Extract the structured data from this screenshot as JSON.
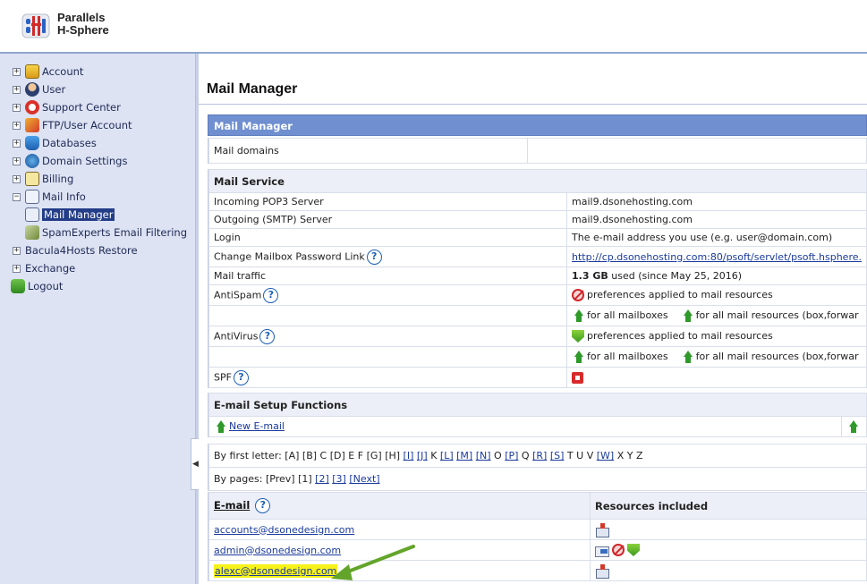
{
  "brand": {
    "line1": "Parallels",
    "line2": "H-Sphere"
  },
  "sidebar": {
    "items": [
      {
        "label": "Account",
        "expander": "+",
        "icon": "account-icon"
      },
      {
        "label": "User",
        "expander": "+",
        "icon": "user-icon"
      },
      {
        "label": "Support Center",
        "expander": "+",
        "icon": "support-lifebuoy-icon"
      },
      {
        "label": "FTP/User Account",
        "expander": "+",
        "icon": "ftp-lock-icon"
      },
      {
        "label": "Databases",
        "expander": "+",
        "icon": "database-icon"
      },
      {
        "label": "Domain Settings",
        "expander": "+",
        "icon": "domain-globe-icon"
      },
      {
        "label": "Billing",
        "expander": "+",
        "icon": "billing-icon"
      },
      {
        "label": "Mail Info",
        "expander": "−",
        "icon": "mail-info-icon"
      },
      {
        "label": "Mail Manager",
        "child": true,
        "selected": true,
        "icon": "mail-manager-icon"
      },
      {
        "label": "SpamExperts Email Filtering",
        "child": true,
        "icon": "spamexperts-icon"
      },
      {
        "label": "Bacula4Hosts Restore",
        "expander": "+",
        "icon": ""
      },
      {
        "label": "Exchange",
        "expander": "+",
        "icon": ""
      },
      {
        "label": "Logout",
        "icon": "logout-icon"
      }
    ]
  },
  "page": {
    "title": "Mail Manager"
  },
  "panel": {
    "header": "Mail Manager",
    "mail_domains_label": "Mail domains",
    "mail_service": {
      "heading": "Mail Service",
      "rows": {
        "pop3_label": "Incoming POP3 Server",
        "pop3_value": "mail9.dsonehosting.com",
        "smtp_label": "Outgoing (SMTP) Server",
        "smtp_value": "mail9.dsonehosting.com",
        "login_label": "Login",
        "login_value": "The e-mail address you use (e.g. user@domain.com)",
        "pwlink_label": "Change Mailbox Password Link",
        "pwlink_value": "http://cp.dsonehosting.com:80/psoft/servlet/psoft.hsphere.",
        "traffic_label": "Mail traffic",
        "traffic_amount": "1.3 GB",
        "traffic_rest": "used (since May 25, 2016)",
        "antispam_label": "AntiSpam",
        "antispam_value": "preferences applied to mail resources",
        "antivirus_label": "AntiVirus",
        "antivirus_value": "preferences applied to mail resources",
        "all_mailboxes": "for all mailboxes",
        "all_resources": "for all mail resources (box,forwar",
        "spf_label": "SPF"
      }
    },
    "setup": {
      "heading": "E-mail Setup Functions",
      "new_email": "New E-mail"
    },
    "letters": {
      "label": "By first letter:",
      "items": [
        {
          "t": "[A]",
          "link": false
        },
        {
          "t": "[B]",
          "link": false
        },
        {
          "t": "C",
          "link": false
        },
        {
          "t": "[D]",
          "link": false
        },
        {
          "t": "E",
          "link": false
        },
        {
          "t": "F",
          "link": false
        },
        {
          "t": "[G]",
          "link": false
        },
        {
          "t": "[H]",
          "link": false
        },
        {
          "t": "[I]",
          "link": true
        },
        {
          "t": "[J]",
          "link": true
        },
        {
          "t": "K",
          "link": false
        },
        {
          "t": "[L]",
          "link": true
        },
        {
          "t": "[M]",
          "link": true
        },
        {
          "t": "[N]",
          "link": true
        },
        {
          "t": "O",
          "link": false
        },
        {
          "t": "[P]",
          "link": true
        },
        {
          "t": "Q",
          "link": false
        },
        {
          "t": "[R]",
          "link": true
        },
        {
          "t": "[S]",
          "link": true
        },
        {
          "t": "T",
          "link": false
        },
        {
          "t": "U",
          "link": false
        },
        {
          "t": "V",
          "link": false
        },
        {
          "t": "[W]",
          "link": true
        },
        {
          "t": "X",
          "link": false
        },
        {
          "t": "Y",
          "link": false
        },
        {
          "t": "Z",
          "link": false
        }
      ]
    },
    "pages": {
      "label": "By pages:",
      "prev": "[Prev]",
      "current": "[1]",
      "p2": "[2]",
      "p3": "[3]",
      "next": "[Next]"
    },
    "email_table": {
      "col_email": "E-mail",
      "col_resources": "Resources included",
      "rows": [
        {
          "email": "accounts@dsonedesign.com",
          "icons": [
            "mailbox-icon"
          ],
          "highlight": false
        },
        {
          "email": "admin@dsonedesign.com",
          "icons": [
            "forward-icon",
            "antispam-icon",
            "antivirus-shield-icon"
          ],
          "highlight": false
        },
        {
          "email": "alexc@dsonedesign.com",
          "icons": [
            "mailbox-icon"
          ],
          "highlight": true
        }
      ]
    }
  },
  "colors": {
    "panel_header": "#6f8fd0",
    "sidebar_bg": "#dde3f3",
    "highlight": "#f7f21a",
    "arrow": "#63a52a"
  }
}
